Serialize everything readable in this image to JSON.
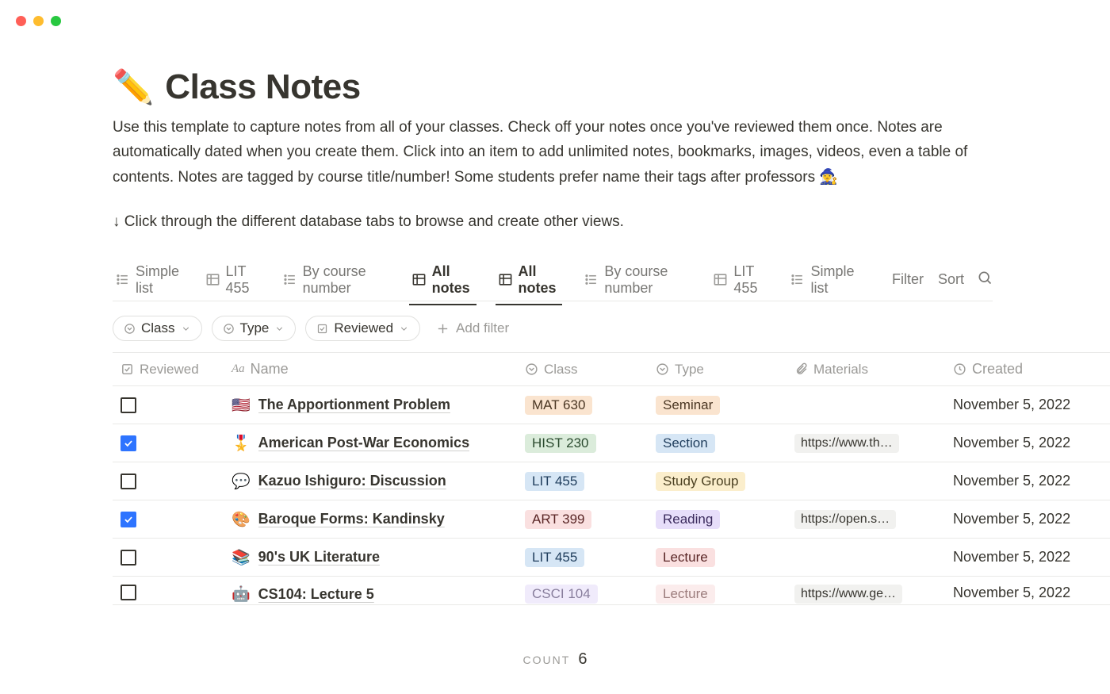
{
  "header": {
    "icon": "✏️",
    "title": "Class Notes",
    "description": "Use this template to capture notes from all of your classes. Check off your notes once you've reviewed them once. Notes are automatically dated when you create them. Click into an item to add unlimited notes, bookmarks, images, videos, even a table of contents. Notes are tagged by course title/number!  Some students prefer name their tags after professors 🧙‍♀️",
    "hint": "↓ Click through the different database tabs to browse and create other views."
  },
  "views": {
    "tabs": [
      {
        "label": "All notes",
        "icon": "table",
        "active": true
      },
      {
        "label": "By course number",
        "icon": "list",
        "active": false
      },
      {
        "label": "LIT 455",
        "icon": "table",
        "active": false
      },
      {
        "label": "Simple list",
        "icon": "list",
        "active": false
      }
    ],
    "actions": {
      "filter": "Filter",
      "sort": "Sort"
    }
  },
  "filters": {
    "pills": [
      {
        "label": "Class",
        "icon": "select"
      },
      {
        "label": "Type",
        "icon": "select"
      },
      {
        "label": "Reviewed",
        "icon": "checkbox"
      }
    ],
    "add_label": "Add filter"
  },
  "table": {
    "columns": {
      "reviewed": "Reviewed",
      "name": "Name",
      "class": "Class",
      "type": "Type",
      "materials": "Materials",
      "created": "Created"
    },
    "rows": [
      {
        "reviewed": false,
        "emoji": "🇺🇸",
        "name": "The Apportionment Problem",
        "class": {
          "label": "MAT 630",
          "bg": "#fae4cf",
          "fg": "#4a3623"
        },
        "type": {
          "label": "Seminar",
          "bg": "#fae4cf",
          "fg": "#4a3623"
        },
        "materials": "",
        "created": "November 5, 2022"
      },
      {
        "reviewed": true,
        "emoji": "🎖️",
        "name": "American Post-War Economics",
        "class": {
          "label": "HIST 230",
          "bg": "#dbecdb",
          "fg": "#2a4a2e"
        },
        "type": {
          "label": "Section",
          "bg": "#d6e6f5",
          "fg": "#1f3d5c"
        },
        "materials": "https://www.th…",
        "created": "November 5, 2022"
      },
      {
        "reviewed": false,
        "emoji": "💬",
        "name": "Kazuo Ishiguro: Discussion",
        "class": {
          "label": "LIT 455",
          "bg": "#d6e6f5",
          "fg": "#1f3d5c"
        },
        "type": {
          "label": "Study Group",
          "bg": "#fbeecc",
          "fg": "#4a3f20"
        },
        "materials": "",
        "created": "November 5, 2022"
      },
      {
        "reviewed": true,
        "emoji": "🎨",
        "name": "Baroque Forms: Kandinsky",
        "class": {
          "label": "ART 399",
          "bg": "#fae0e0",
          "fg": "#5a2626"
        },
        "type": {
          "label": "Reading",
          "bg": "#e7defa",
          "fg": "#3a2a5c"
        },
        "materials": "https://open.s…",
        "created": "November 5, 2022"
      },
      {
        "reviewed": false,
        "emoji": "📚",
        "name": "90's UK Literature",
        "class": {
          "label": "LIT 455",
          "bg": "#d6e6f5",
          "fg": "#1f3d5c"
        },
        "type": {
          "label": "Lecture",
          "bg": "#fae0e0",
          "fg": "#5a2626"
        },
        "materials": "",
        "created": "November 5, 2022"
      },
      {
        "reviewed": false,
        "emoji": "🤖",
        "name": "CS104: Lecture 5",
        "class": {
          "label": "CSCI 104",
          "bg": "#e7defa",
          "fg": "#3a2a5c"
        },
        "type": {
          "label": "Lecture",
          "bg": "#fae0e0",
          "fg": "#5a2626"
        },
        "materials": "https://www.ge…",
        "created": "November 5, 2022",
        "partial": true
      }
    ]
  },
  "footer": {
    "count_label": "COUNT",
    "count_value": "6"
  }
}
